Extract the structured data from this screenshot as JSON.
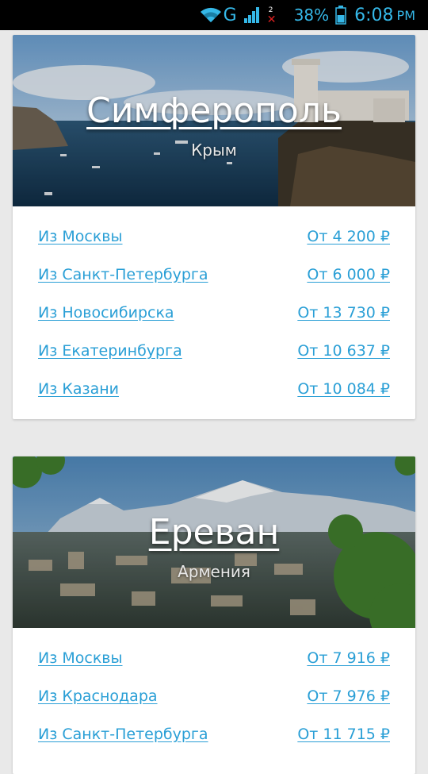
{
  "status_bar": {
    "network": "G",
    "sim_slot": "2",
    "battery": "38%",
    "time": "6:08",
    "ampm": "PM",
    "wifi_icon": "wifi-icon",
    "signal_icon": "signal-bars-icon",
    "battery_icon": "battery-icon"
  },
  "destinations": [
    {
      "city": "Симферополь",
      "region": "Крым",
      "routes": [
        {
          "from": "Из Москвы",
          "price": "От 4 200 ₽"
        },
        {
          "from": "Из Санкт-Петербурга",
          "price": "От 6 000 ₽"
        },
        {
          "from": "Из Новосибирска",
          "price": "От 13 730 ₽"
        },
        {
          "from": "Из Екатеринбурга",
          "price": "От 10 637 ₽"
        },
        {
          "from": "Из Казани",
          "price": "От 10 084 ₽"
        }
      ]
    },
    {
      "city": "Ереван",
      "region": "Армения",
      "routes": [
        {
          "from": "Из Москвы",
          "price": "От 7 916 ₽"
        },
        {
          "from": "Из Краснодара",
          "price": "От 7 976 ₽"
        },
        {
          "from": "Из Санкт-Петербурга",
          "price": "От 11 715 ₽"
        }
      ]
    }
  ],
  "colors": {
    "link": "#2a9fd6",
    "status_accent": "#35b8e8",
    "page_bg": "#e9e9e9"
  }
}
